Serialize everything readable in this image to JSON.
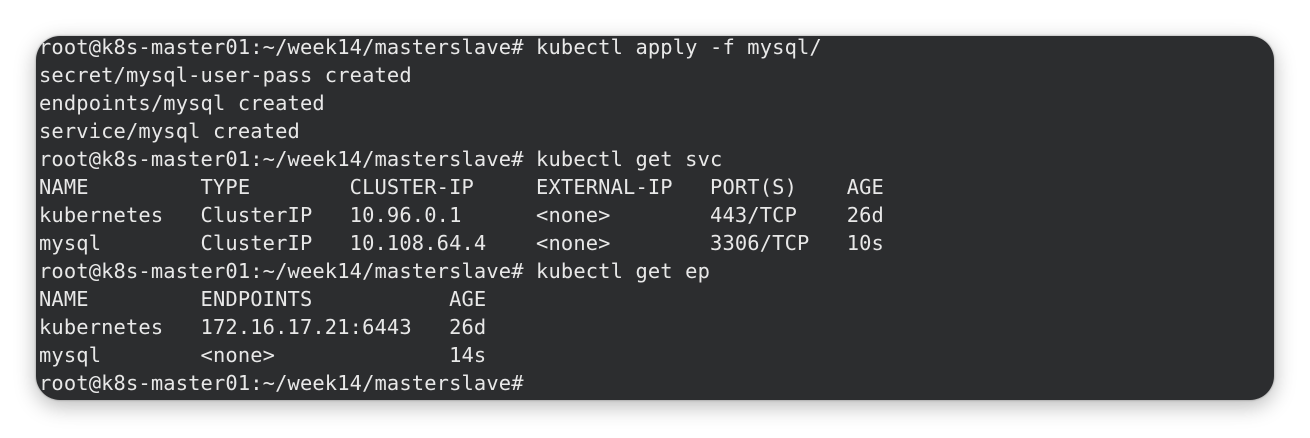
{
  "terminal": {
    "lines": [
      "root@k8s-master01:~/week14/masterslave# kubectl apply -f mysql/",
      "secret/mysql-user-pass created",
      "endpoints/mysql created",
      "service/mysql created",
      "root@k8s-master01:~/week14/masterslave# kubectl get svc",
      "NAME         TYPE        CLUSTER-IP     EXTERNAL-IP   PORT(S)    AGE",
      "kubernetes   ClusterIP   10.96.0.1      <none>        443/TCP    26d",
      "mysql        ClusterIP   10.108.64.4    <none>        3306/TCP   10s",
      "root@k8s-master01:~/week14/masterslave# kubectl get ep",
      "NAME         ENDPOINTS           AGE",
      "kubernetes   172.16.17.21:6443   26d",
      "mysql        <none>              14s",
      "root@k8s-master01:~/week14/masterslave#"
    ]
  }
}
